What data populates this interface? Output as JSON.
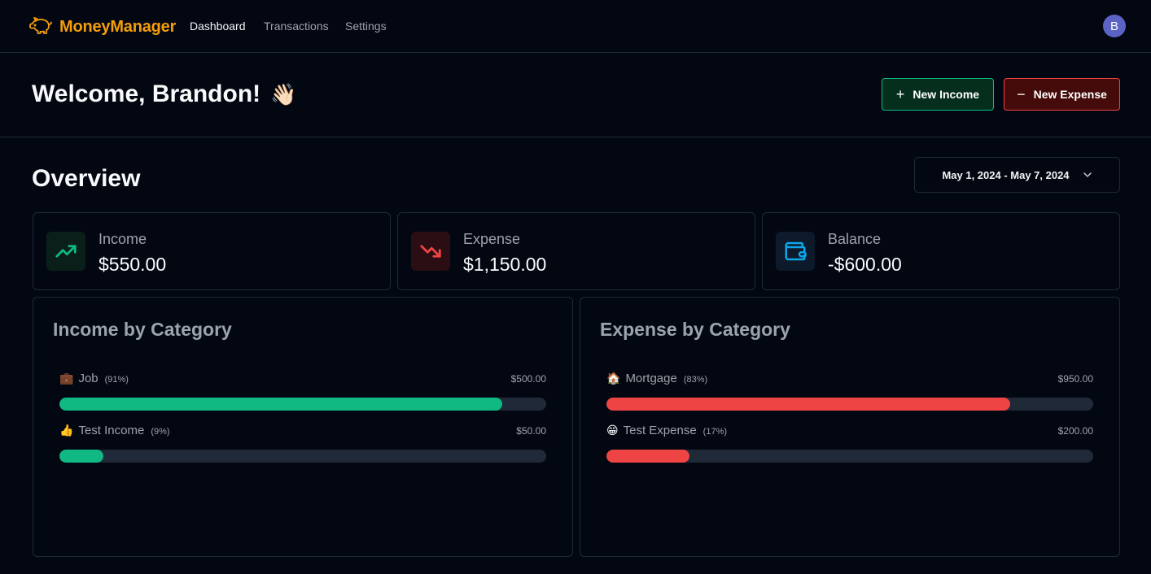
{
  "app": {
    "name": "MoneyManager"
  },
  "nav": [
    {
      "label": "Dashboard",
      "active": true
    },
    {
      "label": "Transactions",
      "active": false
    },
    {
      "label": "Settings",
      "active": false
    }
  ],
  "user": {
    "initial": "B"
  },
  "header": {
    "welcome": "Welcome, Brandon!",
    "wave": "👋🏻",
    "new_income_label": "New Income",
    "new_expense_label": "New Expense"
  },
  "overview": {
    "title": "Overview",
    "date_range": "May 1, 2024 - May 7, 2024"
  },
  "stats": [
    {
      "label": "Income",
      "value": "$550.00",
      "icon": "trending-up-icon",
      "color": "#10b981"
    },
    {
      "label": "Expense",
      "value": "$1,150.00",
      "icon": "trending-down-icon",
      "color": "#ef4444"
    },
    {
      "label": "Balance",
      "value": "-$600.00",
      "icon": "wallet-icon",
      "color": "#0ea5e9"
    }
  ],
  "income_by_category": {
    "title": "Income by Category",
    "color": "#10b981",
    "items": [
      {
        "emoji": "💼",
        "name": "Job",
        "pct_label": "(91%)",
        "amount": "$500.00",
        "fraction": 0.91
      },
      {
        "emoji": "👍",
        "name": "Test Income",
        "pct_label": "(9%)",
        "amount": "$50.00",
        "fraction": 0.09
      }
    ]
  },
  "expense_by_category": {
    "title": "Expense by Category",
    "color": "#ef4444",
    "items": [
      {
        "emoji": "🏠",
        "name": "Mortgage",
        "pct_label": "(83%)",
        "amount": "$950.00",
        "fraction": 0.83
      },
      {
        "emoji": "😁",
        "name": "Test Expense",
        "pct_label": "(17%)",
        "amount": "$200.00",
        "fraction": 0.17
      }
    ]
  }
}
